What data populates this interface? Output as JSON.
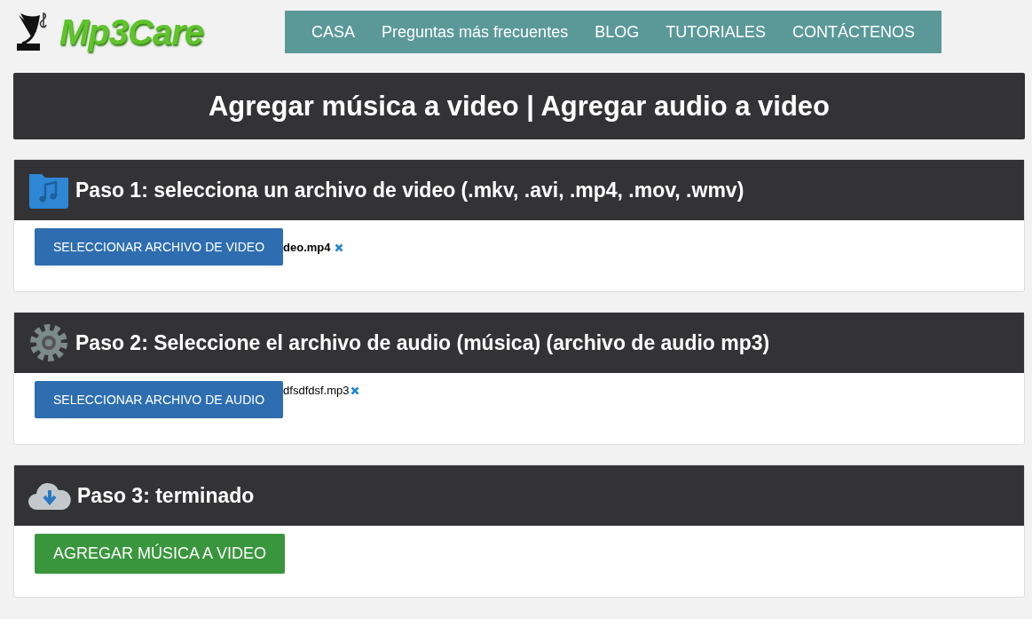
{
  "logo": {
    "text": "Mp3Care"
  },
  "nav": [
    {
      "label": "CASA"
    },
    {
      "label": "Preguntas más frecuentes"
    },
    {
      "label": "BLOG"
    },
    {
      "label": "TUTORIALES"
    },
    {
      "label": "CONTÁCTENOS"
    }
  ],
  "title": "Agregar música a video | Agregar audio a video",
  "steps": [
    {
      "kind": "file",
      "heading": "Paso 1: selecciona un archivo de video (.mkv, .avi, .mp4, .mov, .wmv)",
      "button": "SELECCIONAR ARCHIVO DE VIDEO",
      "filename": "deo.mp4"
    },
    {
      "kind": "file",
      "heading": "Paso 2: Seleccione el archivo de audio (música) (archivo de audio mp3)",
      "button": "SELECCIONAR ARCHIVO DE AUDIO",
      "filename": "dfsdfdsf.mp3"
    },
    {
      "kind": "action",
      "heading": "Paso 3: terminado",
      "button": "AGREGAR MÚSICA A VIDEO"
    }
  ]
}
